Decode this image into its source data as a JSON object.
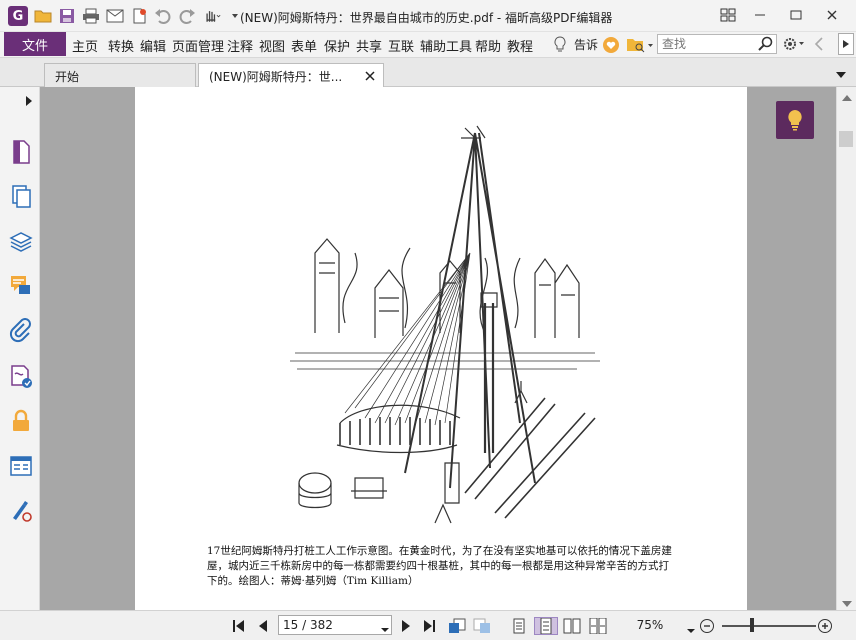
{
  "window": {
    "title": "(NEW)阿姆斯特丹：世界最自由城市的历史.pdf - 福昕高级PDF编辑器",
    "logo_letter": "G",
    "qa_icons": [
      "open-folder-icon",
      "save-icon",
      "print-icon",
      "email-icon",
      "new-doc-icon",
      "undo-icon",
      "redo-icon",
      "hand-tool-icon"
    ]
  },
  "menu": {
    "file": "文件",
    "items": [
      "主页",
      "转换",
      "编辑",
      "页面管理",
      "注释",
      "视图",
      "表单",
      "保护",
      "共享",
      "互联",
      "辅助工具",
      "帮助",
      "教程"
    ],
    "tell_me": "告诉",
    "search_placeholder": "查找"
  },
  "tabs": [
    {
      "label": "开始",
      "active": false
    },
    {
      "label": "(NEW)阿姆斯特丹：世...",
      "active": true
    }
  ],
  "sidebar_icons": [
    "page-thumbnails-icon",
    "pages-icon",
    "layers-icon",
    "comments-icon",
    "attachments-icon",
    "signature-icon",
    "security-icon",
    "form-fields-icon",
    "certify-icon"
  ],
  "document": {
    "caption": "17世纪阿姆斯特丹打桩工人工作示意图。在黄金时代，为了在没有坚实地基可以依托的情况下盖房建屋，城内近三千栋新房中的每一栋都需要约四十根基桩，其中的每一根都是用这种异常辛苦的方式打下的。绘图人：蒂姆·基列姆（Tim Killiam）"
  },
  "status": {
    "page_display": "15 / 382",
    "zoom": "75%"
  },
  "colors": {
    "brand": "#6a2f78",
    "hint_button": "#5c2a5e",
    "workspace": "#a7a7a7"
  }
}
